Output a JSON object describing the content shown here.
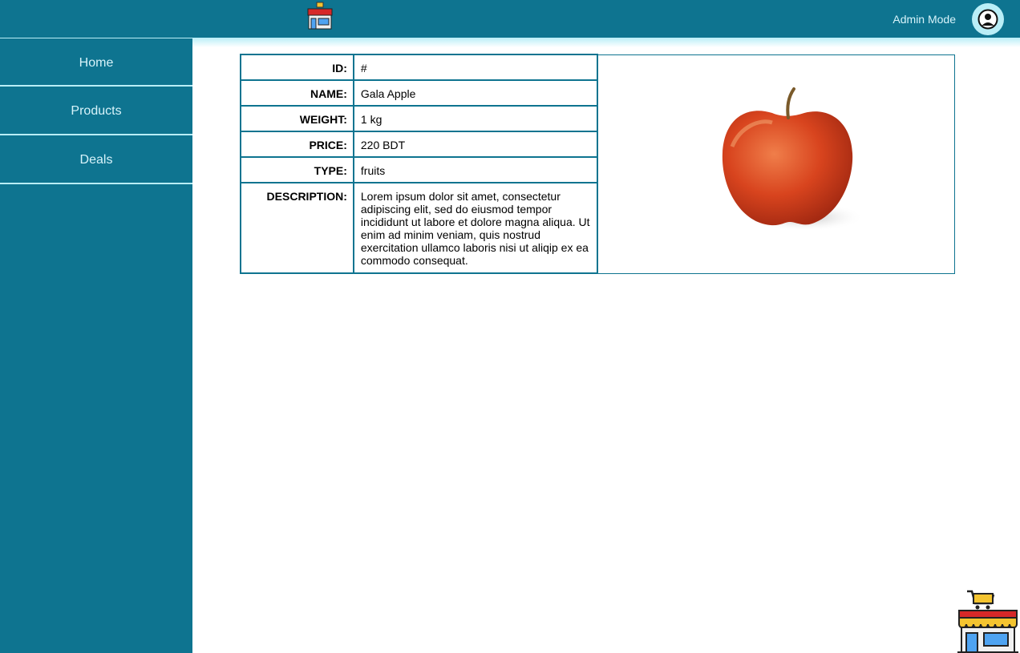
{
  "header": {
    "logo_icon": "store-icon",
    "admin_mode_label": "Admin Mode",
    "profile_icon": "user-circle-icon",
    "colors": {
      "primary": "#0e7490",
      "accent": "#b9eef7",
      "text_light": "#d7f3fa"
    }
  },
  "sidebar": {
    "items": [
      {
        "label": "Home"
      },
      {
        "label": "Products"
      },
      {
        "label": "Deals"
      }
    ]
  },
  "product": {
    "id_label": "ID:",
    "id_value": "#",
    "name_label": "NAME:",
    "name_value": "Gala Apple",
    "weight_label": "WEIGHT:",
    "weight_value": "1 kg",
    "price_label": "PRICE:",
    "price_value": "220 BDT",
    "type_label": "TYPE:",
    "type_value": "fruits",
    "description_label": "DESCRIPTION:",
    "description_value": "Lorem ipsum dolor sit amet, consectetur adipiscing elit, sed do eiusmod tempor incididunt ut labore et dolore magna aliqua. Ut enim ad minim veniam, quis nostrud exercitation ullamco laboris nisi ut aliqip ex ea commodo consequat.",
    "image_icon": "apple-image"
  },
  "footer": {
    "store_icon": "store-cart-icon"
  }
}
